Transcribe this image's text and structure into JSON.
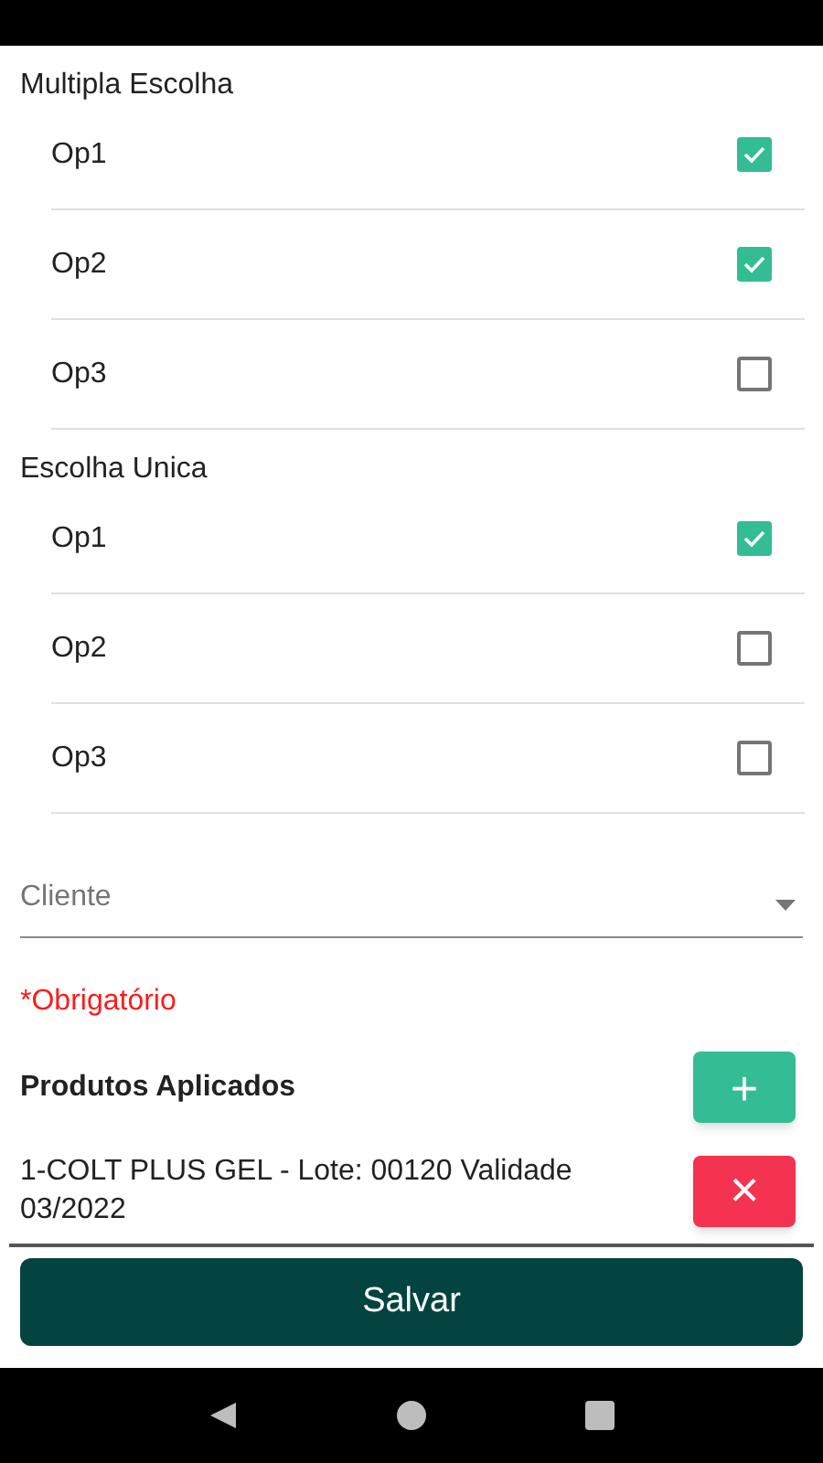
{
  "groups": [
    {
      "title": "Multipla Escolha",
      "options": [
        {
          "label": "Op1",
          "checked": true
        },
        {
          "label": "Op2",
          "checked": true
        },
        {
          "label": "Op3",
          "checked": false
        }
      ]
    },
    {
      "title": "Escolha Unica",
      "options": [
        {
          "label": "Op1",
          "checked": true
        },
        {
          "label": "Op2",
          "checked": false
        },
        {
          "label": "Op3",
          "checked": false
        }
      ]
    }
  ],
  "client_field": {
    "placeholder": "Cliente"
  },
  "required_note": "*Obrigatório",
  "products": {
    "title": "Produtos Aplicados",
    "add_button": "+",
    "items": [
      {
        "text": "1-COLT PLUS GEL - Lote: 00120 Validade 03/2022",
        "remove_button": "×"
      }
    ]
  },
  "save_button": "Salvar"
}
